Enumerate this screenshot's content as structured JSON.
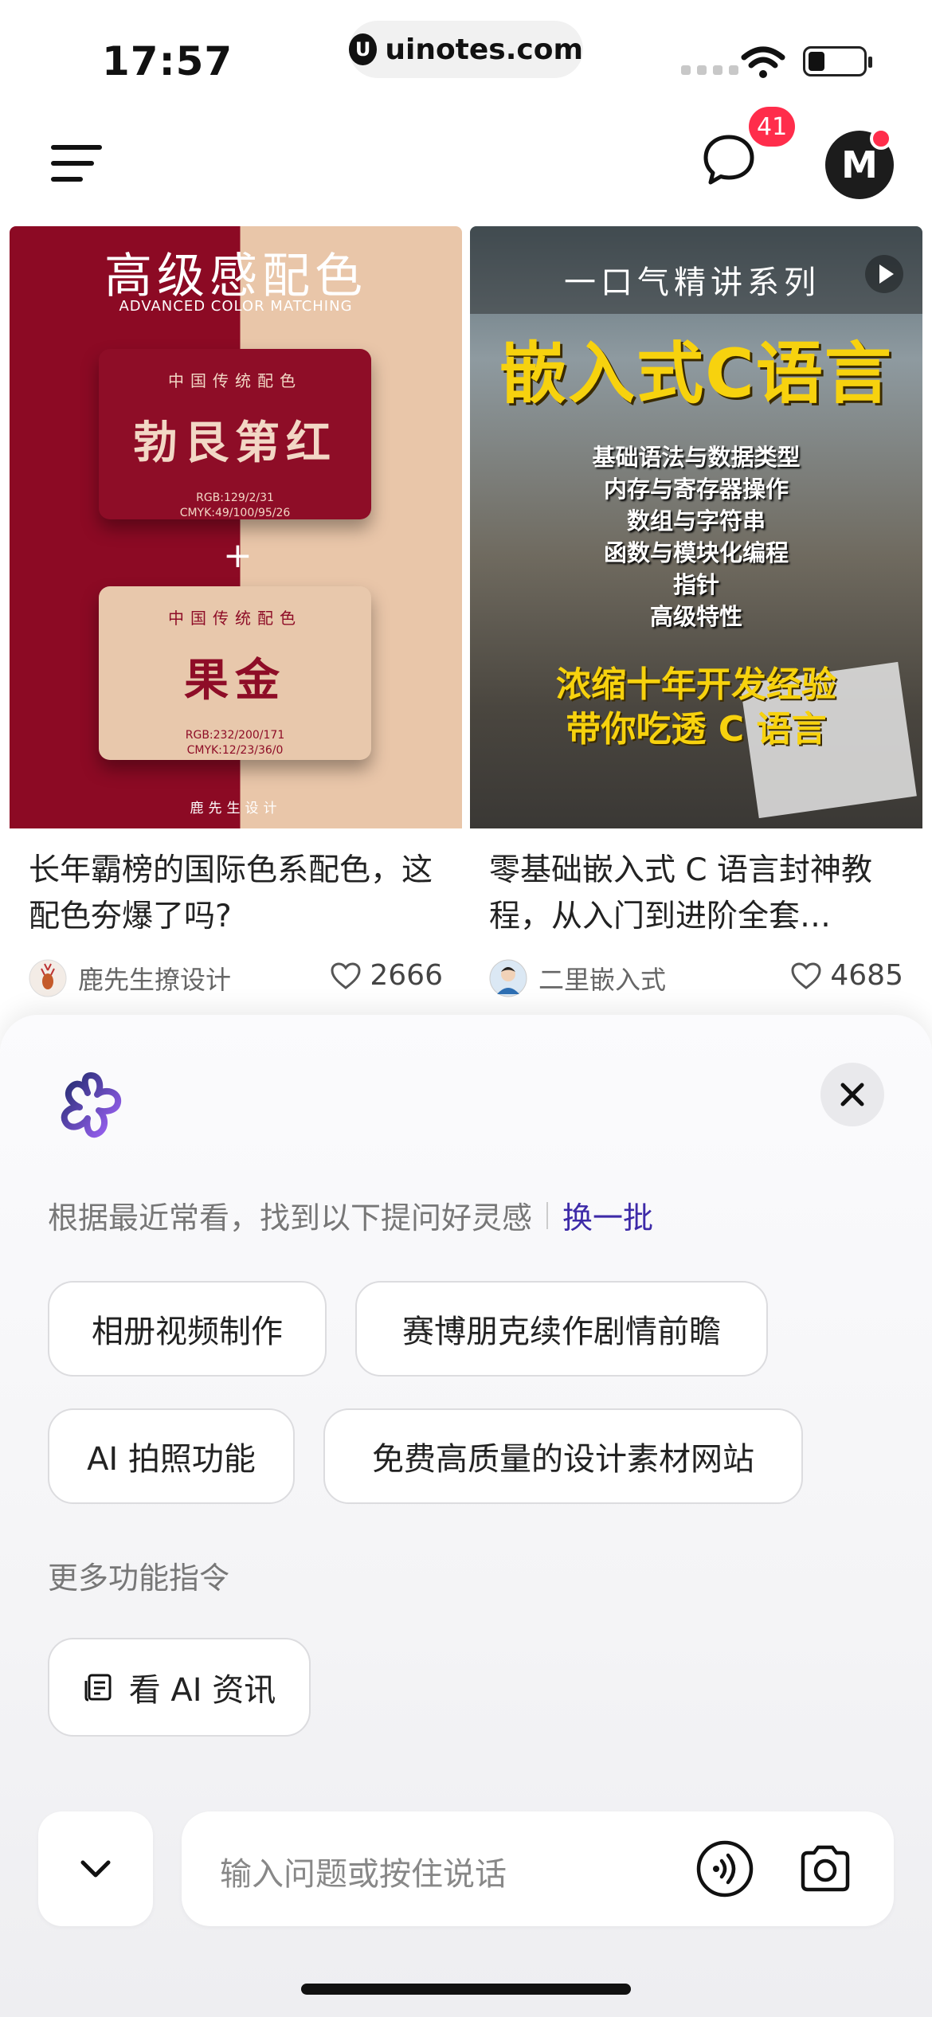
{
  "status_bar": {
    "time": "17:57",
    "url": "uinotes.com",
    "url_logo": "U"
  },
  "header": {
    "message_badge": "41",
    "avatar_letter": "M"
  },
  "feed": {
    "cards": [
      {
        "title": "长年霸榜的国际色系配色，这配色夯爆了吗?",
        "author": "鹿先生撩设计",
        "likes": "2666",
        "image": {
          "heading": "高级感配色",
          "subheading": "ADVANCED COLOR MATCHING",
          "swatch1": {
            "label": "中国传统配色",
            "name": "勃艮第红",
            "rgb": "RGB:129/2/31",
            "cmyk": "CMYK:49/100/95/26"
          },
          "plus": "+",
          "swatch2": {
            "label": "中国传统配色",
            "name": "果金",
            "rgb": "RGB:232/200/171",
            "cmyk": "CMYK:12/23/36/0"
          },
          "signature": "鹿先生设计"
        }
      },
      {
        "title": "零基础嵌入式 C 语言封神教程，从入门到进阶全套…",
        "author": "二里嵌入式",
        "likes": "4685",
        "image": {
          "series": "一口气精讲系列",
          "main": "嵌入式C语言",
          "topics": [
            "基础语法与数据类型",
            "内存与寄存器操作",
            "数组与字符串",
            "函数与模块化编程",
            "指针",
            "高级特性"
          ],
          "slogan1": "浓缩十年开发经验",
          "slogan2": "带你吃透 C 语言"
        }
      }
    ]
  },
  "assistant_sheet": {
    "hint": "根据最近常看，找到以下提问好灵感",
    "refresh_label": "换一批",
    "suggestions": [
      "相册视频制作",
      "赛博朋克续作剧情前瞻",
      "AI 拍照功能",
      "免费高质量的设计素材网站"
    ],
    "more_title": "更多功能指令",
    "news_button": "看 AI 资讯",
    "input_placeholder": "输入问题或按住说话"
  },
  "colors": {
    "accent": "#3d2aa8",
    "badge": "#ff2d4b",
    "burgundy": "#8e0d27",
    "gold_swatch": "#e8c8ac",
    "caption_yellow": "#f7d20e"
  }
}
